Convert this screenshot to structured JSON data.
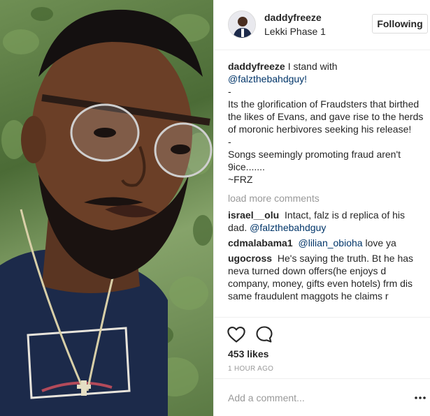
{
  "post": {
    "username": "daddyfreeze",
    "location": "Lekki Phase 1",
    "follow_label": "Following",
    "caption": {
      "username": "daddyfreeze",
      "line1": "I stand with",
      "mention": "@falzthebahdguy!",
      "sep1": "-",
      "body1": "Its the glorification of Fraudsters that birthed the likes of Evans, and gave rise to the herds of moronic herbivores seeking his release!",
      "sep2": "-",
      "body2": "Songs seemingly promoting fraud aren't 9ice.......",
      "signoff": "~FRZ"
    },
    "load_more": "load more comments",
    "comments": [
      {
        "username": "israel__olu",
        "text": "Intact, falz is d replica of his dad.",
        "mention": "@falzthebahdguy"
      },
      {
        "username": "cdmalabama1",
        "mention": "@lilian_obioha",
        "text": "love ya"
      },
      {
        "username": "ugocross",
        "text": "He's saying the truth. Bt he has neva turned down offers(he enjoys d company, money, gifts even hotels) frm dis same fraudulent maggots he claims r"
      }
    ],
    "likes": "453 likes",
    "timestamp": "1 HOUR AGO",
    "add_comment_placeholder": "Add a comment..."
  },
  "icons": {
    "like": "heart-icon",
    "comment": "comment-bubble-icon",
    "more": "more-options-icon",
    "avatar": "avatar"
  },
  "colors": {
    "mention": "#003569",
    "muted": "#999999",
    "text": "#262626",
    "border": "#efefef"
  }
}
